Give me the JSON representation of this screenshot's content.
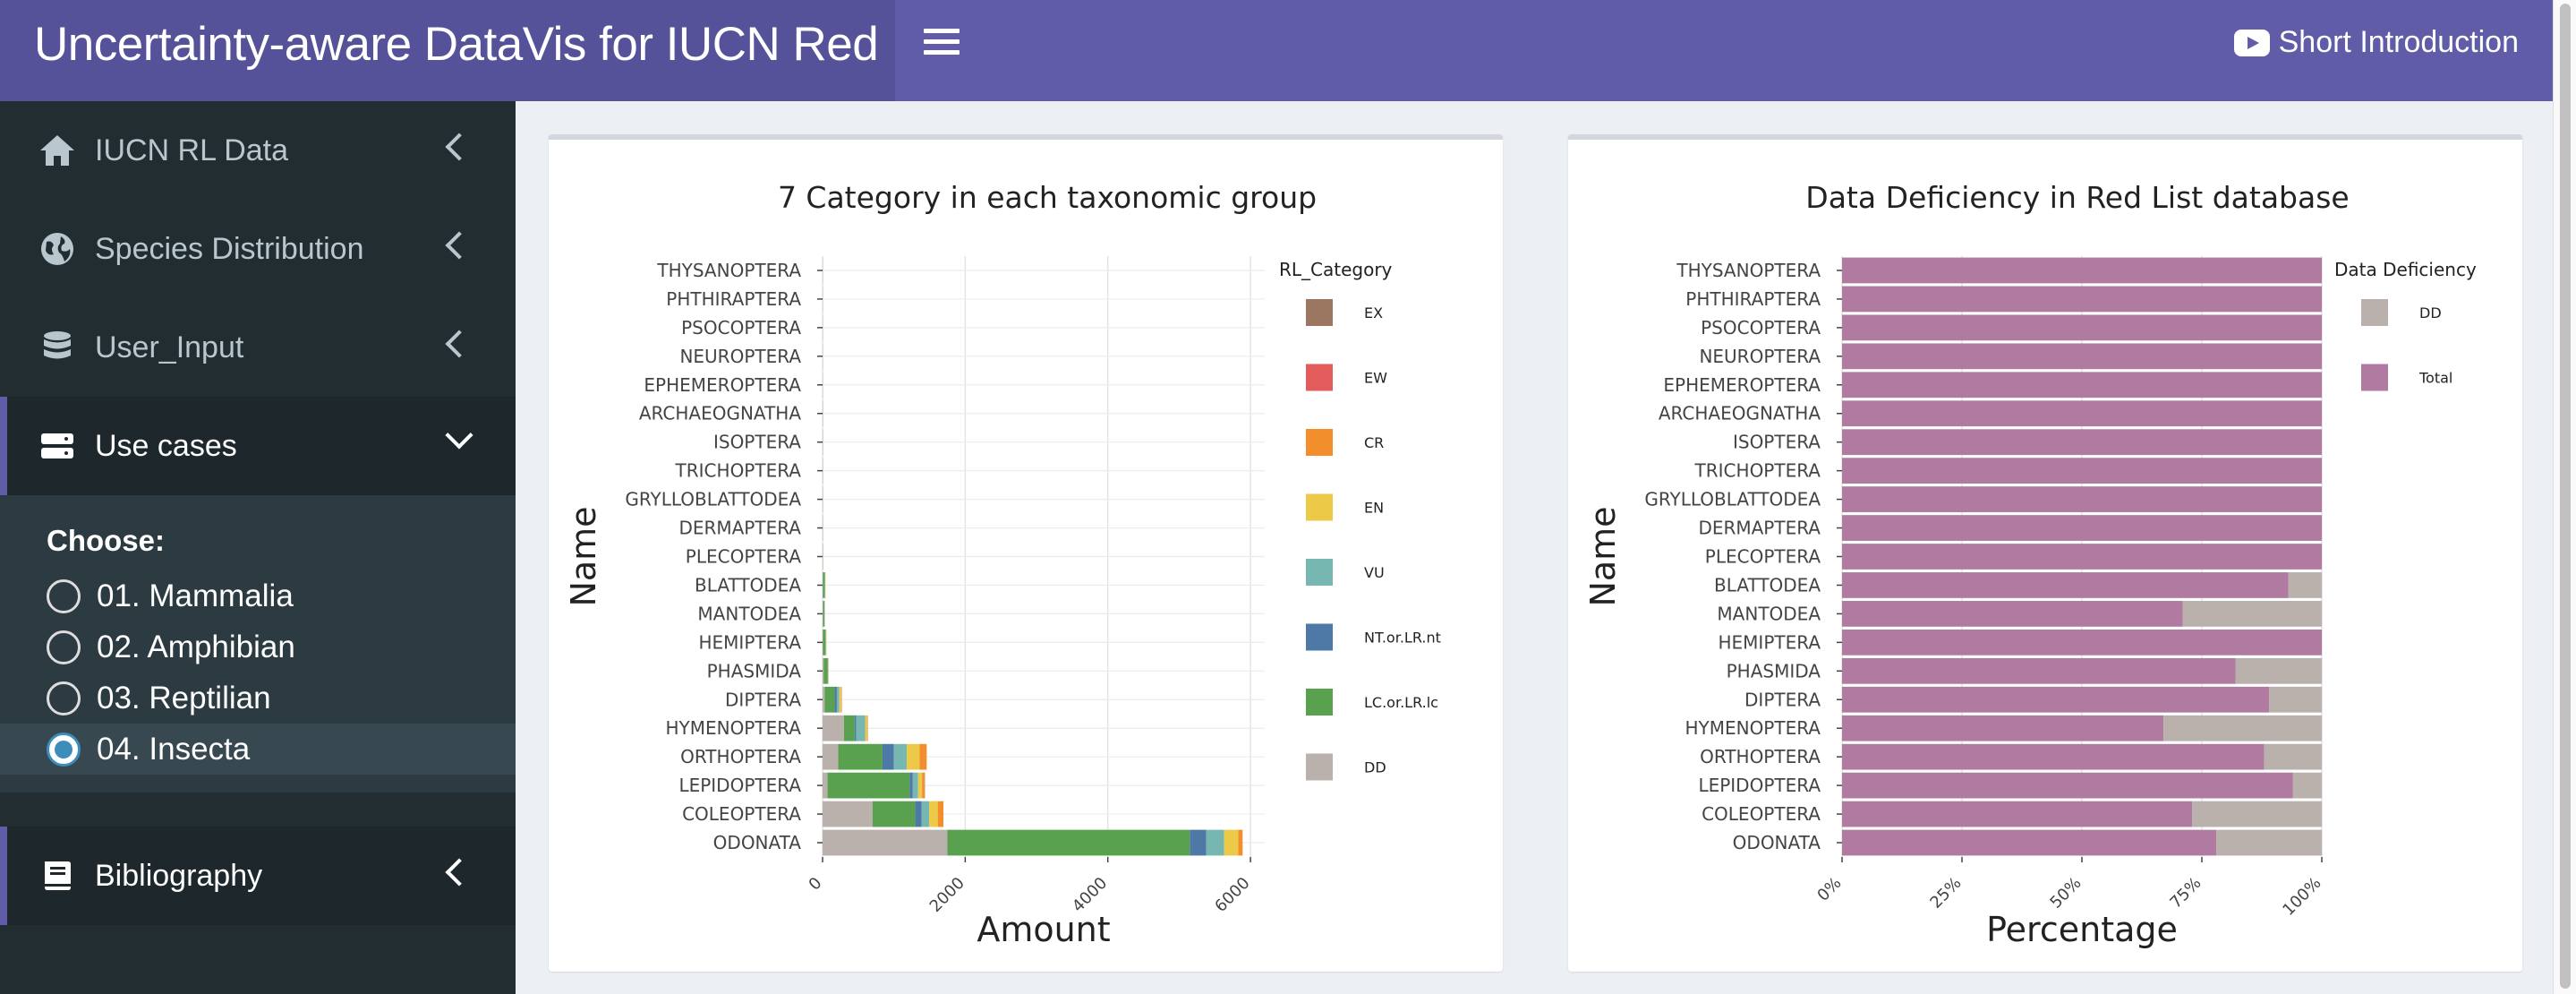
{
  "header": {
    "title": "Uncertainty-aware DataVis for IUCN Red List",
    "intro_label": "Short Introduction"
  },
  "sidebar": {
    "items": [
      {
        "label": "IUCN RL Data",
        "icon": "home-icon"
      },
      {
        "label": "Species Distribution",
        "icon": "globe-icon"
      },
      {
        "label": "User_Input",
        "icon": "database-icon"
      },
      {
        "label": "Use cases",
        "icon": "server-icon"
      }
    ],
    "choose_label": "Choose:",
    "options": [
      "01. Mammalia",
      "02. Amphibian",
      "03. Reptilian",
      "04. Insecta"
    ],
    "selected_option": "04. Insecta",
    "bibliography_label": "Bibliography"
  },
  "chart_data": [
    {
      "type": "bar",
      "orientation": "horizontal",
      "stacked": true,
      "title": "7 Category in each taxonomic group",
      "xlabel": "Amount",
      "ylabel": "Name",
      "xlim": [
        0,
        6200
      ],
      "xticks": [
        0,
        2000,
        4000,
        6000
      ],
      "legend_title": "RL_Category",
      "legend_position": "right",
      "categories": [
        "THYSANOPTERA",
        "PHTHIRAPTERA",
        "PSOCOPTERA",
        "NEUROPTERA",
        "EPHEMEROPTERA",
        "ARCHAEOGNATHA",
        "ISOPTERA",
        "TRICHOPTERA",
        "GRYLLOBLATTODEA",
        "DERMAPTERA",
        "PLECOPTERA",
        "BLATTODEA",
        "MANTODEA",
        "HEMIPTERA",
        "PHASMIDA",
        "DIPTERA",
        "HYMENOPTERA",
        "ORTHOPTERA",
        "LEPIDOPTERA",
        "COLEOPTERA",
        "ODONATA"
      ],
      "series": [
        {
          "name": "EX",
          "color": "#9b7660",
          "values": [
            0,
            0,
            0,
            0,
            0,
            0,
            0,
            0,
            0,
            0,
            0,
            0,
            0,
            0,
            0,
            0,
            0,
            0,
            5,
            0,
            0
          ]
        },
        {
          "name": "EW",
          "color": "#e35b5b",
          "values": [
            0,
            0,
            0,
            0,
            0,
            0,
            0,
            0,
            0,
            0,
            0,
            0,
            0,
            0,
            0,
            0,
            0,
            0,
            0,
            0,
            0
          ]
        },
        {
          "name": "CR",
          "color": "#f28e2b",
          "values": [
            0,
            0,
            0,
            0,
            0,
            0,
            0,
            0,
            0,
            0,
            0,
            2,
            0,
            2,
            2,
            10,
            10,
            100,
            35,
            80,
            60
          ]
        },
        {
          "name": "EN",
          "color": "#edc948",
          "values": [
            0,
            0,
            0,
            0,
            0,
            0,
            0,
            0,
            0,
            0,
            0,
            3,
            0,
            5,
            4,
            25,
            25,
            180,
            55,
            120,
            200
          ]
        },
        {
          "name": "VU",
          "color": "#76b7b2",
          "values": [
            0,
            0,
            0,
            0,
            0,
            0,
            0,
            0,
            0,
            0,
            0,
            4,
            2,
            5,
            5,
            35,
            130,
            180,
            75,
            105,
            250
          ]
        },
        {
          "name": "NT.or.LR.nt",
          "color": "#4e79a7",
          "values": [
            0,
            0,
            0,
            0,
            0,
            0,
            0,
            0,
            0,
            0,
            0,
            2,
            1,
            3,
            4,
            30,
            20,
            160,
            45,
            90,
            230
          ]
        },
        {
          "name": "LC.or.LR.lc",
          "color": "#59a14f",
          "values": [
            2,
            2,
            2,
            2,
            2,
            3,
            3,
            3,
            3,
            3,
            4,
            25,
            20,
            35,
            55,
            140,
            150,
            620,
            1150,
            600,
            3400
          ]
        },
        {
          "name": "DD",
          "color": "#bab0ac",
          "values": [
            0,
            0,
            0,
            0,
            0,
            0,
            0,
            0,
            0,
            0,
            0,
            5,
            8,
            5,
            15,
            30,
            300,
            220,
            70,
            700,
            1750
          ]
        }
      ]
    },
    {
      "type": "bar",
      "orientation": "horizontal",
      "stacked": true,
      "title": "Data Deficiency in Red List database",
      "xlabel": "Percentage",
      "ylabel": "Name",
      "xlim": [
        0,
        1
      ],
      "xticks": [
        "0%",
        "25%",
        "50%",
        "75%",
        "100%"
      ],
      "legend_title": "Data Deficiency",
      "legend_position": "right",
      "categories": [
        "THYSANOPTERA",
        "PHTHIRAPTERA",
        "PSOCOPTERA",
        "NEUROPTERA",
        "EPHEMEROPTERA",
        "ARCHAEOGNATHA",
        "ISOPTERA",
        "TRICHOPTERA",
        "GRYLLOBLATTODEA",
        "DERMAPTERA",
        "PLECOPTERA",
        "BLATTODEA",
        "MANTODEA",
        "HEMIPTERA",
        "PHASMIDA",
        "DIPTERA",
        "HYMENOPTERA",
        "ORTHOPTERA",
        "LEPIDOPTERA",
        "COLEOPTERA",
        "ODONATA"
      ],
      "series": [
        {
          "name": "Total",
          "color": "#b07aa1",
          "values": [
            1,
            1,
            1,
            1,
            1,
            1,
            1,
            1,
            1,
            1,
            1,
            0.93,
            0.71,
            1,
            0.82,
            0.89,
            0.67,
            0.88,
            0.94,
            0.73,
            0.78
          ]
        },
        {
          "name": "DD",
          "color": "#bab0ac",
          "values": [
            0,
            0,
            0,
            0,
            0,
            0,
            0,
            0,
            0,
            0,
            0,
            0.07,
            0.29,
            0,
            0.18,
            0.11,
            0.33,
            0.12,
            0.06,
            0.27,
            0.22
          ]
        }
      ]
    }
  ]
}
